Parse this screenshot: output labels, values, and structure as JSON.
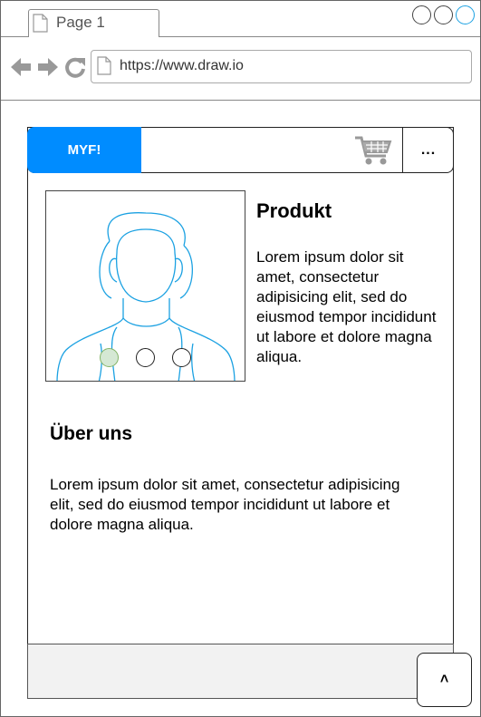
{
  "browser": {
    "tab_title": "Page 1",
    "url": "https://www.draw.io"
  },
  "header": {
    "brand": "MYF!",
    "menu_label": "..."
  },
  "product": {
    "title": "Produkt",
    "description": "Lorem ipsum dolor sit amet, consectetur adipisicing elit, sed do eiusmod tempor incididunt ut labore et dolore magna aliqua.",
    "carousel": {
      "count": 3,
      "active_index": 1
    }
  },
  "about": {
    "title": "Über uns",
    "text": "Lorem ipsum dolor sit amet, consectetur adipisicing elit, sed do eiusmod tempor incididunt ut labore et dolore magna aliqua."
  },
  "footer": {
    "scroll_top_label": "˄"
  },
  "colors": {
    "brand": "#008cff",
    "carousel_active_fill": "#d5e8d4",
    "carousel_active_stroke": "#82b366",
    "footer_bg": "#f2f2f2",
    "avatar_stroke": "#1ba1e2"
  }
}
